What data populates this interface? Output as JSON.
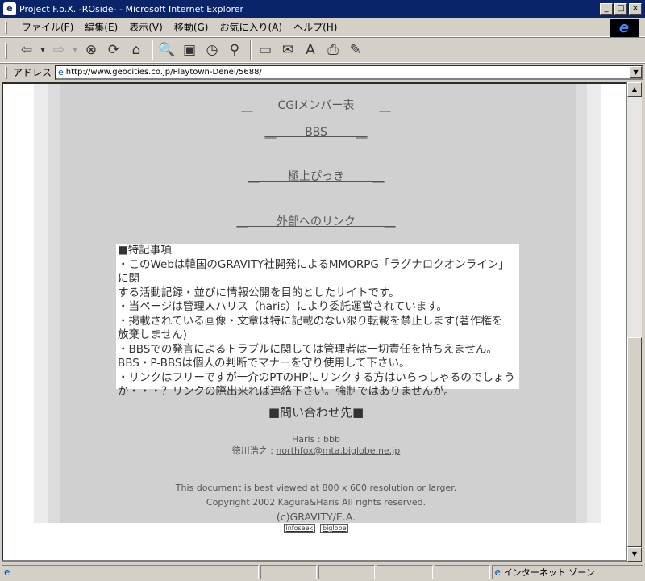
{
  "window": {
    "title": "Project F.o.X. -ROside- - Microsoft Internet Explorer",
    "min": "_",
    "max": "□",
    "close": "×"
  },
  "menu": [
    "ファイル(F)",
    "編集(E)",
    "表示(V)",
    "移動(G)",
    "お気に入り(A)",
    "ヘルプ(H)"
  ],
  "toolbar": {
    "back_icon": "⇦",
    "back_arrow": "▾",
    "forward_icon": "⇨",
    "forward_arrow": "▾",
    "stop_icon": "⊗",
    "refresh_icon": "⟳",
    "home_icon": "⌂",
    "search_icon": "🔍",
    "favorites_icon": "▣",
    "history_icon": "◷",
    "channels_icon": "⚲",
    "fullscreen_icon": "▭",
    "mail_icon": "✉",
    "font_icon": "A",
    "print_icon": "⎙",
    "edit_icon": "✎"
  },
  "address": {
    "label": "アドレス",
    "url": "http://www.geocities.co.jp/Playtown-Denei/5688/",
    "page_icon": "e",
    "dropdown": "▼"
  },
  "ie_logo": "e",
  "content": {
    "nav_links": [
      {
        "pre": "__",
        "label": "CGIメンバー表",
        "post": "__",
        "underlined": false
      },
      {
        "pre": "__",
        "label": "BBS",
        "post": "__",
        "underlined": true
      },
      {
        "pre": "__",
        "label": "極上ぴっき",
        "post": "__",
        "underlined": true
      },
      {
        "pre": "__",
        "label": "外部へのリンク",
        "post": "__",
        "underlined": true
      }
    ],
    "notice_lines": [
      "■特記事項",
      "・このWebは韓国のGRAVITY社開発によるMMORPG「ラグナロクオンライン」に関",
      "する活動記録・並びに情報公開を目的としたサイトです。",
      "・当ページは管理人ハリス（haris）により委託運営されています。",
      "・掲載されている画像・文章は特に記載のない限り転載を禁止します(著作権を",
      "放棄しません)",
      "・BBSでの発言によるトラブルに関しては管理者は一切責任を持ちえません。",
      "BBS・P-BBSは個人の判断でマナーを守り使用して下さい。",
      "・リンクはフリーですが一介のPTのHPにリンクする方はいらっしゃるのでしょう",
      "か・・・？リンクの際出来れば連絡下さい。強制ではありませんが。"
    ],
    "contact_title": "■問い合わせ先■",
    "contact_line1": "Haris : bbb",
    "contact_name": "徳川浩之 : ",
    "contact_email": "northfox@mta.biglobe.ne.jp",
    "footer1": "This document is best viewed at 800 x 600 resolution or larger.",
    "footer2": "Copyright 2002 Kagura&Haris All rights reserved.",
    "footer3": "(c)GRAVITY/E.A.",
    "badges": [
      "infoseek",
      "biglobe"
    ]
  },
  "scrollbar": {
    "up": "▲",
    "down": "▼"
  },
  "status": {
    "icon": "e",
    "zone_icon": "e",
    "zone": "インターネット ゾーン"
  }
}
